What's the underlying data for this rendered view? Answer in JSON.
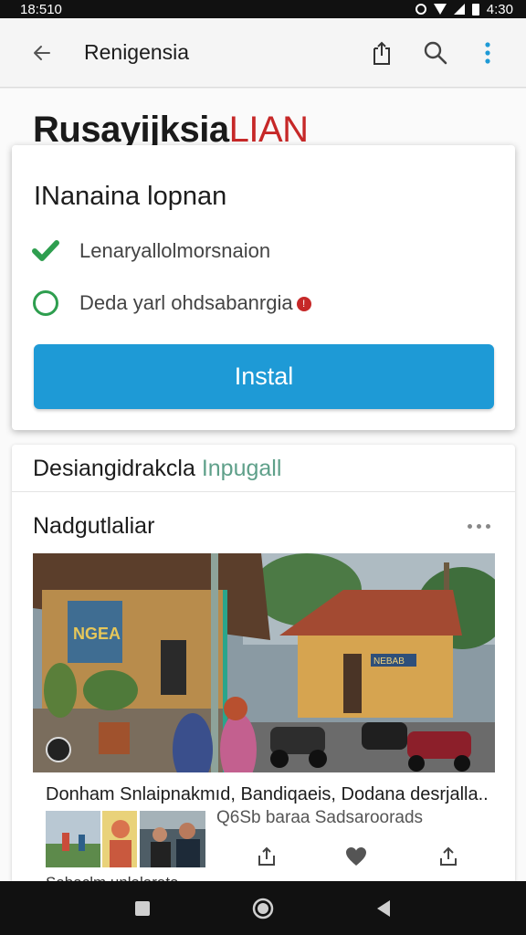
{
  "status": {
    "time": "18:510",
    "battery": "4:30"
  },
  "app_bar": {
    "title": "Renigensia"
  },
  "hero": {
    "title": "Rusayijksia",
    "accent": "LIAN"
  },
  "dialog": {
    "title": "INanaina lopnan",
    "options": [
      {
        "label": "Lenaryallolmorsnaion",
        "checked": true
      },
      {
        "label": "Deda yarl ohdsabanrgia",
        "checked": false
      }
    ],
    "install_label": "Instal"
  },
  "card": {
    "header": "Desiangidrakcla",
    "header_link": "Inpugall",
    "section_title": "Nadgutlaliar",
    "photo_sign": "NGEA",
    "photo_sign_right": "NEBAB",
    "caption": "Donham Snlaipnakmıd, Bandiqaeis, Dodana desrjalla..",
    "meta": "Q6Sb baraa Sadsaroorads",
    "cut_text": "Sabaclm unlalarata"
  },
  "colors": {
    "accent": "#1e9ad6",
    "check": "#2e9e4f",
    "warning": "#c62828"
  }
}
